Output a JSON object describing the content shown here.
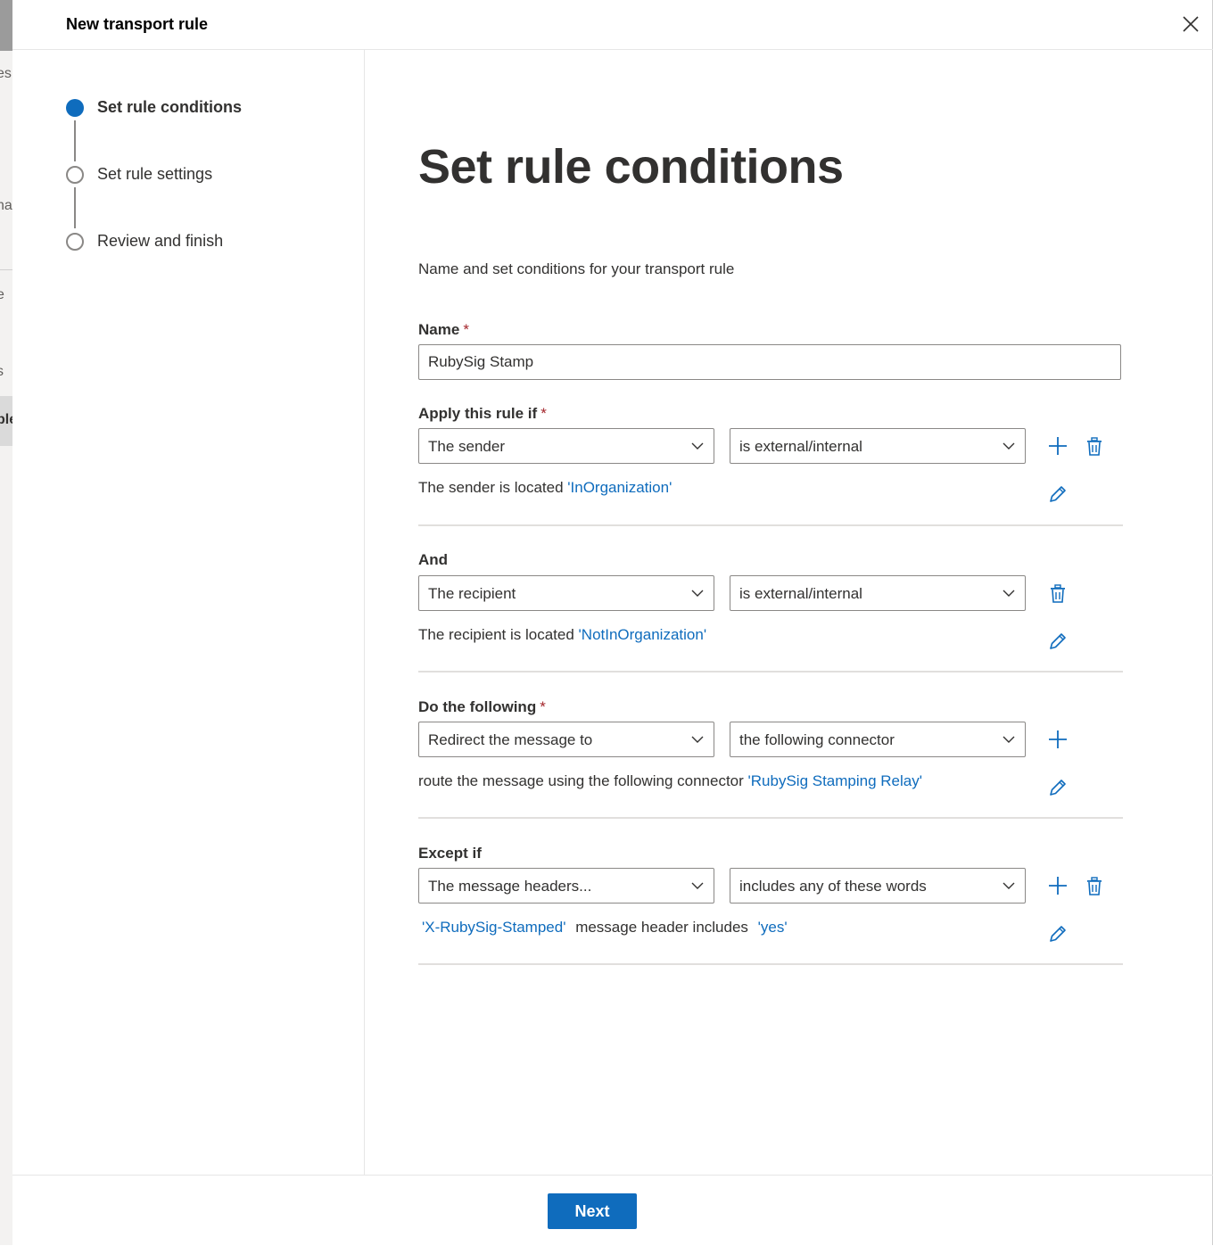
{
  "background": {
    "fragments": [
      "es",
      "na",
      "e",
      "s",
      "ble"
    ]
  },
  "dialog": {
    "title": "New transport rule",
    "close_icon": "close-icon"
  },
  "steps": [
    {
      "label": "Set rule conditions",
      "state": "active"
    },
    {
      "label": "Set rule settings",
      "state": "pending"
    },
    {
      "label": "Review and finish",
      "state": "pending"
    }
  ],
  "main": {
    "title": "Set rule conditions",
    "subtitle": "Name and set conditions for your transport rule",
    "required_marker": "*",
    "name_label": "Name",
    "name_value": "RubySig Stamp",
    "sections": {
      "apply": {
        "label": "Apply this rule if",
        "select1": "The sender",
        "select2": "is external/internal",
        "desc_text": "The sender is located ",
        "desc_link": "'InOrganization'"
      },
      "and": {
        "label": "And",
        "select1": "The recipient",
        "select2": "is external/internal",
        "desc_text": "The recipient is located ",
        "desc_link": "'NotInOrganization'"
      },
      "do": {
        "label": "Do the following",
        "select1": "Redirect the message to",
        "select2": "the following connector",
        "desc_text": "route the message using the following connector ",
        "desc_link": "'RubySig Stamping Relay'"
      },
      "except": {
        "label": "Except if",
        "select1": "The message headers...",
        "select2": "includes any of these words",
        "desc_link1": "'X-RubySig-Stamped'",
        "desc_text": "message header includes",
        "desc_link2": "'yes'"
      }
    }
  },
  "footer": {
    "next_label": "Next"
  },
  "colors": {
    "accent": "#0f6cbd",
    "required": "#a4262c",
    "text": "#323130",
    "border": "#8a8886"
  }
}
